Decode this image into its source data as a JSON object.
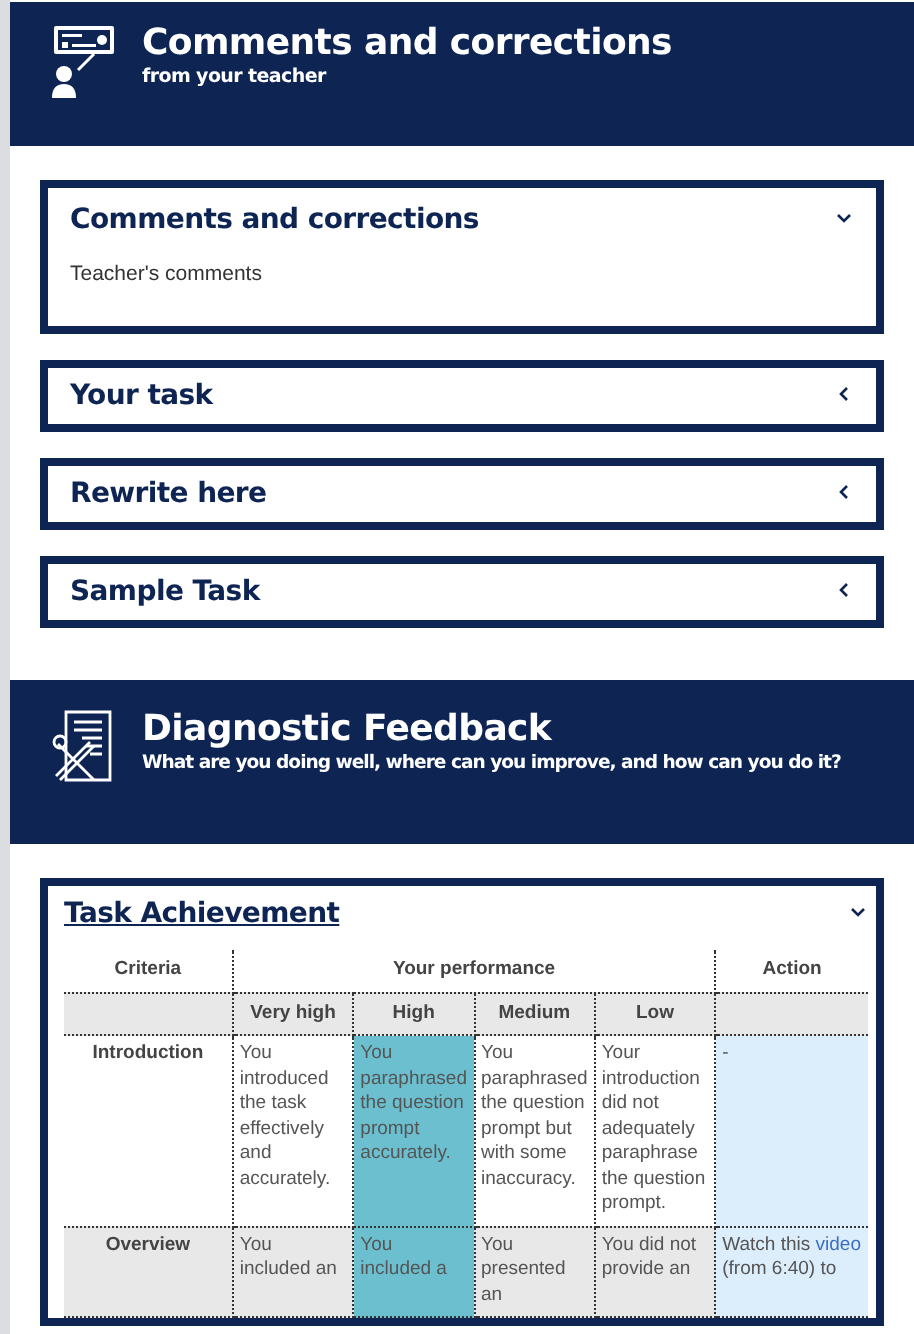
{
  "header": {
    "title": "Comments and corrections",
    "subtitle": "from your teacher"
  },
  "accordions": [
    {
      "title": "Comments and corrections",
      "expanded": true,
      "body": "Teacher's comments"
    },
    {
      "title": "Your task",
      "expanded": false
    },
    {
      "title": "Rewrite here",
      "expanded": false
    },
    {
      "title": "Sample Task",
      "expanded": false
    }
  ],
  "feedback_header": {
    "title": "Diagnostic Feedback",
    "subtitle": "What are you doing well, where can you improve, and how can you do it?"
  },
  "rubric": {
    "title": "Task Achievement",
    "expanded": true,
    "columns": {
      "criteria": "Criteria",
      "performance": "Your performance",
      "action": "Action"
    },
    "levels": [
      "Very high",
      "High",
      "Medium",
      "Low"
    ],
    "rows": [
      {
        "criterion": "Introduction",
        "cells": [
          {
            "text": "You introduced the task effectively and accurately.",
            "selected": false
          },
          {
            "text": "You paraphrased the question prompt accurately.",
            "selected": true
          },
          {
            "text": "You paraphrased the question prompt but with some inaccuracy.",
            "selected": false
          },
          {
            "text": "Your introduction did not adequately paraphrase the question prompt.",
            "selected": false
          }
        ],
        "action": {
          "before": "-"
        }
      },
      {
        "criterion": "Overview",
        "cells": [
          {
            "text": "You included an",
            "selected": false
          },
          {
            "text": "You included a",
            "selected": true
          },
          {
            "text": "You presented an",
            "selected": false
          },
          {
            "text": "You did not provide an",
            "selected": false
          }
        ],
        "action": {
          "before": "Watch this ",
          "link": "video",
          "after": " (from 6:40) to"
        }
      }
    ]
  }
}
